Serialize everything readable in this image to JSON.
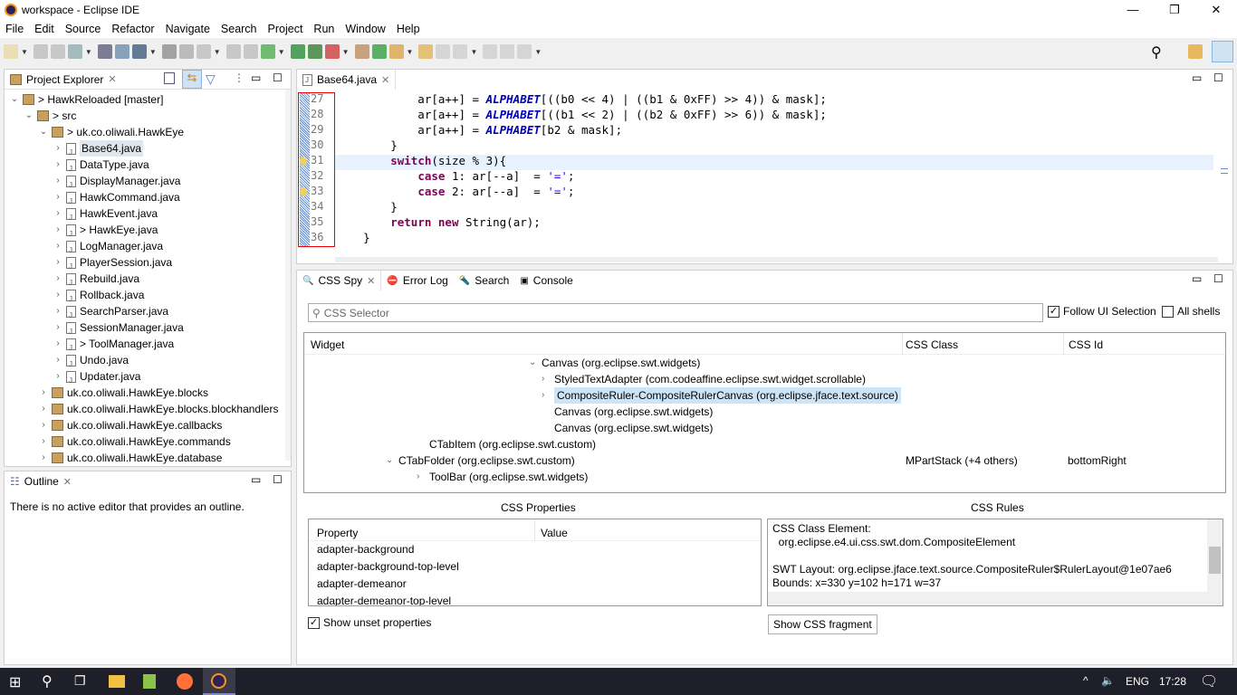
{
  "window": {
    "title": "workspace - Eclipse IDE",
    "minimize": "—",
    "maximize": "❐",
    "close": "✕"
  },
  "menu": [
    "File",
    "Edit",
    "Source",
    "Refactor",
    "Navigate",
    "Search",
    "Project",
    "Run",
    "Window",
    "Help"
  ],
  "explorer": {
    "tab": "Project Explorer",
    "items": [
      {
        "label": "> HawkReloaded [master]",
        "level": 0,
        "kind": "project",
        "expanded": true
      },
      {
        "label": "> src",
        "level": 1,
        "kind": "folder",
        "expanded": true
      },
      {
        "label": "> uk.co.oliwali.HawkEye",
        "level": 2,
        "kind": "package",
        "expanded": true
      },
      {
        "label": "Base64.java",
        "level": 3,
        "kind": "file",
        "selected": true
      },
      {
        "label": "DataType.java",
        "level": 3,
        "kind": "file"
      },
      {
        "label": "DisplayManager.java",
        "level": 3,
        "kind": "file"
      },
      {
        "label": "HawkCommand.java",
        "level": 3,
        "kind": "file"
      },
      {
        "label": "HawkEvent.java",
        "level": 3,
        "kind": "file"
      },
      {
        "label": "> HawkEye.java",
        "level": 3,
        "kind": "file"
      },
      {
        "label": "LogManager.java",
        "level": 3,
        "kind": "file"
      },
      {
        "label": "PlayerSession.java",
        "level": 3,
        "kind": "file"
      },
      {
        "label": "Rebuild.java",
        "level": 3,
        "kind": "file"
      },
      {
        "label": "Rollback.java",
        "level": 3,
        "kind": "file"
      },
      {
        "label": "SearchParser.java",
        "level": 3,
        "kind": "file"
      },
      {
        "label": "SessionManager.java",
        "level": 3,
        "kind": "file"
      },
      {
        "label": "> ToolManager.java",
        "level": 3,
        "kind": "file"
      },
      {
        "label": "Undo.java",
        "level": 3,
        "kind": "file"
      },
      {
        "label": "Updater.java",
        "level": 3,
        "kind": "file"
      },
      {
        "label": "uk.co.oliwali.HawkEye.blocks",
        "level": 2,
        "kind": "package"
      },
      {
        "label": "uk.co.oliwali.HawkEye.blocks.blockhandlers",
        "level": 2,
        "kind": "package"
      },
      {
        "label": "uk.co.oliwali.HawkEye.callbacks",
        "level": 2,
        "kind": "package"
      },
      {
        "label": "uk.co.oliwali.HawkEye.commands",
        "level": 2,
        "kind": "package"
      },
      {
        "label": "uk.co.oliwali.HawkEye.database",
        "level": 2,
        "kind": "package"
      }
    ]
  },
  "outline": {
    "tab": "Outline",
    "message": "There is no active editor that provides an outline."
  },
  "editor": {
    "tab": "Base64.java",
    "lines": [
      {
        "n": "27",
        "html": "            ar[a++] = <span class='const'>ALPHABET</span>[((b0 &lt;&lt; 4) | ((b1 &amp; 0xFF) &gt;&gt; 4)) &amp; mask];"
      },
      {
        "n": "28",
        "html": "            ar[a++] = <span class='const'>ALPHABET</span>[((b1 &lt;&lt; 2) | ((b2 &amp; 0xFF) &gt;&gt; 6)) &amp; mask];"
      },
      {
        "n": "29",
        "html": "            ar[a++] = <span class='const'>ALPHABET</span>[b2 &amp; mask];"
      },
      {
        "n": "30",
        "html": "        }"
      },
      {
        "n": "31",
        "html": "        <span class='kw'>switch</span>(size % 3){"
      },
      {
        "n": "32",
        "html": "            <span class='kw'>case</span> 1: ar[--a]  = <span class='str'>'='</span>;"
      },
      {
        "n": "33",
        "html": "            <span class='kw'>case</span> 2: ar[--a]  = <span class='str'>'='</span>;"
      },
      {
        "n": "34",
        "html": "        }"
      },
      {
        "n": "35",
        "html": "        <span class='kw'>return</span> <span class='kw'>new</span> String(ar);"
      },
      {
        "n": "36",
        "html": "    }"
      }
    ]
  },
  "bottom": {
    "tabs": [
      "CSS Spy",
      "Error Log",
      "Search",
      "Console"
    ],
    "selector_placeholder": "CSS Selector",
    "follow_ui": "Follow UI Selection",
    "all_shells": "All shells",
    "columns": [
      "Widget",
      "CSS Class",
      "CSS Id"
    ],
    "rows": [
      {
        "indent": 4,
        "chev": "v",
        "widget": "Canvas (org.eclipse.swt.widgets)",
        "cls": "",
        "id": ""
      },
      {
        "indent": 5,
        "chev": ">",
        "widget": "StyledTextAdapter (com.codeaffine.eclipse.swt.widget.scrollable)",
        "cls": "",
        "id": ""
      },
      {
        "indent": 5,
        "chev": ">",
        "widget": "CompositeRuler-CompositeRulerCanvas (org.eclipse.jface.text.source)",
        "cls": "",
        "id": "",
        "selected": true
      },
      {
        "indent": 5,
        "chev": "",
        "widget": "Canvas (org.eclipse.swt.widgets)",
        "cls": "",
        "id": ""
      },
      {
        "indent": 5,
        "chev": "",
        "widget": "Canvas (org.eclipse.swt.widgets)",
        "cls": "",
        "id": ""
      },
      {
        "indent": 3,
        "chev": "",
        "widget": "CTabItem (org.eclipse.swt.custom)",
        "cls": "",
        "id": ""
      },
      {
        "indent": 2,
        "chev": "v",
        "widget": "CTabFolder (org.eclipse.swt.custom)",
        "cls": "MPartStack (+4 others)",
        "id": "bottomRight"
      },
      {
        "indent": 3,
        "chev": ">",
        "widget": "ToolBar (org.eclipse.swt.widgets)",
        "cls": "",
        "id": ""
      }
    ],
    "props_title": "CSS Properties",
    "props_cols": [
      "Property",
      "Value"
    ],
    "props": [
      "adapter-background",
      "adapter-background-top-level",
      "adapter-demeanor",
      "adapter-demeanor-top-level"
    ],
    "show_unset": "Show unset properties",
    "rules_title": "CSS Rules",
    "rules": [
      "CSS Class Element:",
      "  org.eclipse.e4.ui.css.swt.dom.CompositeElement",
      "",
      "SWT Layout: org.eclipse.jface.text.source.CompositeRuler$RulerLayout@1e07ae6",
      "Bounds: x=330 y=102 h=171 w=37"
    ],
    "show_fragment": "Show CSS fragment"
  },
  "taskbar": {
    "lang": "ENG",
    "time": "17:28"
  }
}
